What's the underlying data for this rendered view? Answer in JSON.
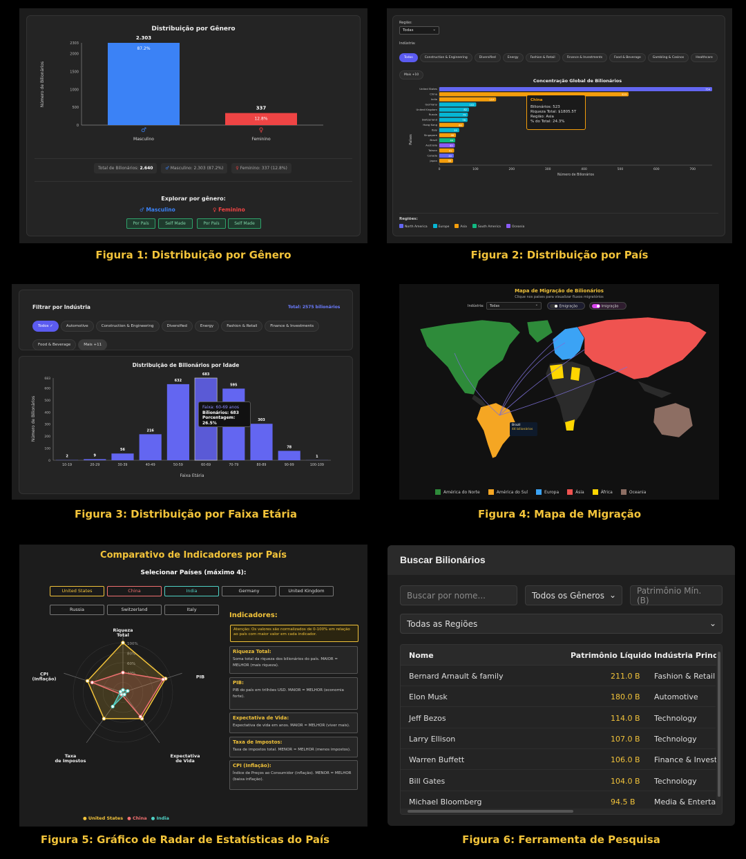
{
  "captions": {
    "f1": "Figura 1: Distribuição por Gênero",
    "f2": "Figura 2: Distribuição por País",
    "f3": "Figura 3: Distribuição por Faixa Etária",
    "f4": "Figura 4: Mapa de Migração",
    "f5": "Figura 5: Gráfico de Radar de Estatísticas do País",
    "f6": "Figura 6: Ferramenta de Pesquisa"
  },
  "fig1": {
    "title": "Distribuição por Gênero",
    "ylabel": "Número de Bilionários",
    "yticks": [
      "2303",
      "2000",
      "1500",
      "1000",
      "500",
      "0"
    ],
    "bars": [
      {
        "label": "Masculino",
        "value": 2303,
        "top": "2.303",
        "pct": "87.2%",
        "color": "#3b82f6",
        "icon": "♂"
      },
      {
        "label": "Feminino",
        "value": 337,
        "top": "337",
        "pct": "12.8%",
        "color": "#ef4444",
        "icon": "♀"
      }
    ],
    "stats": {
      "total_label": "Total de Bilionários:",
      "total_value": "2.640",
      "male": "Masculino: 2.303 (87.2%)",
      "female": "Feminino: 337 (12.8%)"
    },
    "explore_title": "Explorar por gênero:",
    "male_link": "♂ Masculino",
    "female_link": "♀ Feminino",
    "buttons": [
      "Por País",
      "Self Made",
      "Por País",
      "Self Made"
    ]
  },
  "fig2": {
    "region_label": "Região:",
    "region_value": "Todas",
    "industry_label": "Indústria:",
    "chips": [
      "Todos",
      "Construction & Engineering",
      "Diversified",
      "Energy",
      "Fashion & Retail",
      "Finance & Investments",
      "Food & Beverage",
      "Gambling & Casinos",
      "Healthcare",
      "Mais +10"
    ],
    "title": "Concentração Global de Bilionários",
    "ylabel": "Países",
    "xlabel": "Número de Bilionários",
    "xticks": [
      "0",
      "100",
      "200",
      "300",
      "400",
      "500",
      "600",
      "700"
    ],
    "legend_title": "Regiões:",
    "legend": [
      {
        "name": "North America",
        "color": "#6366f1"
      },
      {
        "name": "Europe",
        "color": "#06b6d4"
      },
      {
        "name": "Asia",
        "color": "#f59e0b"
      },
      {
        "name": "South America",
        "color": "#10b981"
      },
      {
        "name": "Oceania",
        "color": "#8b5cf6"
      }
    ],
    "tooltip": {
      "title": "China",
      "l1": "Bilionários: 523",
      "l2": "Riqueza Total: $1805.5T",
      "l3": "Região: Asia",
      "l4": "% do Total: 24.3%"
    }
  },
  "fig3": {
    "filter_title": "Filtrar por Indústria",
    "total": "Total: 2575 bilionários",
    "chips": [
      "Todos ✓",
      "Automotive",
      "Construction & Engineering",
      "Diversified",
      "Energy",
      "Fashion & Retail",
      "Finance & Investments",
      "Food & Beverage",
      "Mais +11"
    ],
    "title": "Distribuição de Bilionários por Idade",
    "ylabel": "Número de Bilionários",
    "xlabel": "Faixa Etária",
    "yticks": [
      "683",
      "600",
      "500",
      "400",
      "300",
      "200",
      "100",
      "0"
    ],
    "tooltip": {
      "title": "Faixa: 60-69 anos",
      "l1": "Bilionários: 683",
      "l2": "Porcentagem: 26.5%"
    }
  },
  "fig4": {
    "title": "Mapa de Migração de Bilionários",
    "subtitle": "Clique nos países para visualizar fluxos migratórios",
    "industry_label": "Indústria:",
    "industry_value": "Todas",
    "toggle1": "Emigração",
    "toggle2": "Imigração",
    "tooltip_country": "Brazil",
    "tooltip_value": "44 bilionários",
    "legend": [
      {
        "name": "América do Norte",
        "color": "#2e8b3a"
      },
      {
        "name": "América do Sul",
        "color": "#f5a623"
      },
      {
        "name": "Europa",
        "color": "#3ba3f5"
      },
      {
        "name": "Ásia",
        "color": "#ef5350"
      },
      {
        "name": "África",
        "color": "#ffd600"
      },
      {
        "name": "Oceania",
        "color": "#8d6e63"
      }
    ]
  },
  "fig5": {
    "title": "Comparativo de Indicadores por País",
    "select_label": "Selecionar Países (máximo 4):",
    "countries": [
      {
        "name": "United States",
        "color": "#f2c33a",
        "on": true
      },
      {
        "name": "China",
        "color": "#f07070",
        "on": true
      },
      {
        "name": "India",
        "color": "#4fd1c5",
        "on": true
      },
      {
        "name": "Germany",
        "color": "#888",
        "on": false
      },
      {
        "name": "United Kingdom",
        "color": "#888",
        "on": false
      },
      {
        "name": "Russia",
        "color": "#888",
        "on": false
      },
      {
        "name": "Switzerland",
        "color": "#888",
        "on": false
      },
      {
        "name": "Italy",
        "color": "#888",
        "on": false
      }
    ],
    "axes": [
      "Riqueza Total",
      "PIB",
      "Expectativa de Vida",
      "Taxa de Impostos",
      "CPI (Inflação)"
    ],
    "axis_lines": {
      "a0": "Riqueza",
      "a0b": "Total",
      "a2": "Expectativa",
      "a2b": "de Vida",
      "a3": "Taxa",
      "a3b": "de Impostos",
      "a4": "CPI",
      "a4b": "(Inflação)"
    },
    "rings": [
      "100%",
      "80%",
      "60%",
      "40%"
    ],
    "series": [
      {
        "name": "United States",
        "color": "#f2c33a",
        "values": [
          1.0,
          0.9,
          0.65,
          0.65,
          0.75
        ]
      },
      {
        "name": "China",
        "color": "#f07070",
        "values": [
          0.4,
          0.85,
          0.6,
          0.05,
          0.65
        ]
      },
      {
        "name": "India",
        "color": "#4fd1c5",
        "values": [
          0.05,
          0.1,
          0.05,
          0.35,
          0.05
        ]
      }
    ],
    "legend": [
      "● United States",
      "● China",
      "● India"
    ],
    "ind_title": "Indicadores:",
    "warning": "Atenção: Os valores são normalizados de 0-100% em relação ao país com maior valor em cada indicador.",
    "indicators": [
      {
        "t": "Riqueza Total:",
        "d": "Soma total da riqueza dos bilionários do país. MAIOR = MELHOR (mais riqueza)."
      },
      {
        "t": "PIB:",
        "d": "PIB do país em trilhões USD. MAIOR = MELHOR (economia forte)."
      },
      {
        "t": "Expectativa de Vida:",
        "d": "Expectativa de vida em anos. MAIOR = MELHOR (viver mais)."
      },
      {
        "t": "Taxa de Impostos:",
        "d": "Taxa de impostos total. MENOR = MELHOR (menos impostos)."
      },
      {
        "t": "CPI (Inflação):",
        "d": "Índice de Preços ao Consumidor (inflação). MENOR = MELHOR (baixa inflação)."
      }
    ]
  },
  "fig6": {
    "title": "Buscar Bilionários",
    "search_placeholder": "Buscar por nome...",
    "gender_value": "Todos os Gêneros",
    "networth_placeholder": "Patrimônio Mín. (B)",
    "region_value": "Todas as Regiões",
    "headers": [
      "Nome",
      "Patrimônio Líquido",
      "Indústria Principal"
    ],
    "rows": [
      [
        "Bernard Arnault & family",
        "211.0 B",
        "Fashion & Retail"
      ],
      [
        "Elon Musk",
        "180.0 B",
        "Automotive"
      ],
      [
        "Jeff Bezos",
        "114.0 B",
        "Technology"
      ],
      [
        "Larry Ellison",
        "107.0 B",
        "Technology"
      ],
      [
        "Warren Buffett",
        "106.0 B",
        "Finance & Investments"
      ],
      [
        "Bill Gates",
        "104.0 B",
        "Technology"
      ],
      [
        "Michael Bloomberg",
        "94.5 B",
        "Media & Entertainment"
      ]
    ]
  },
  "chart_data": [
    {
      "type": "bar",
      "title": "Distribuição por Gênero",
      "categories": [
        "Masculino",
        "Feminino"
      ],
      "values": [
        2303,
        337
      ],
      "ylabel": "Número de Bilionários",
      "ylim": [
        0,
        2303
      ]
    },
    {
      "type": "bar",
      "title": "Concentração Global de Bilionários",
      "orientation": "horizontal",
      "categories": [
        "United States",
        "China",
        "India",
        "Germany",
        "United Kingdom",
        "Russia",
        "Switzerland",
        "Hong Kong",
        "Italy",
        "Singapore",
        "Brazil",
        "Australia",
        "Taiwan",
        "Canada",
        "Japan"
      ],
      "values": [
        754,
        523,
        157,
        102,
        82,
        79,
        78,
        68,
        55,
        46,
        44,
        43,
        41,
        40,
        38
      ],
      "regions": [
        "North America",
        "Asia",
        "Asia",
        "Europe",
        "Europe",
        "Europe",
        "Europe",
        "Asia",
        "Europe",
        "Asia",
        "South America",
        "Oceania",
        "Asia",
        "North America",
        "Asia"
      ],
      "value_labels": [
        "754",
        "523",
        "157",
        "102",
        "82",
        "79",
        "78",
        "68",
        "55",
        "46",
        "44",
        "43",
        "41",
        "40",
        "38"
      ],
      "xlabel": "Número de Bilionários",
      "ylabel": "Países",
      "xlim": [
        0,
        754
      ]
    },
    {
      "type": "bar",
      "title": "Distribuição de Bilionários por Idade",
      "categories": [
        "10-19",
        "20-29",
        "30-39",
        "40-49",
        "50-59",
        "60-69",
        "70-79",
        "80-89",
        "90-99",
        "100-109"
      ],
      "values": [
        2,
        9,
        56,
        216,
        632,
        683,
        595,
        303,
        78,
        1
      ],
      "xlabel": "Faixa Etária",
      "ylabel": "Número de Bilionários",
      "ylim": [
        0,
        683
      ]
    }
  ]
}
